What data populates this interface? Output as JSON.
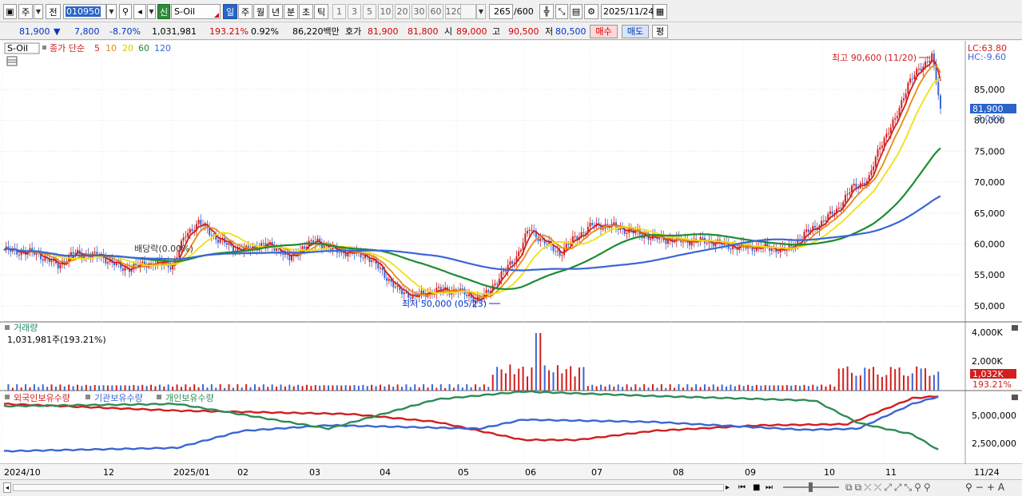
{
  "toolbar": {
    "market_button": "주",
    "prev_button": "전",
    "stock_code": "010950",
    "badge": "신",
    "stock_name": "S-Oil",
    "periods": [
      "일",
      "주",
      "월",
      "년",
      "분",
      "초",
      "틱"
    ],
    "active_period": "일",
    "minute_intervals": [
      "1",
      "3",
      "5",
      "10",
      "20",
      "30",
      "60",
      "120"
    ],
    "count_value": "265",
    "count_max": "/600",
    "date": "2025/11/24"
  },
  "quote": {
    "price": "81,900",
    "change": "7,800",
    "change_pct": "-8.70%",
    "volume": "1,031,981",
    "volume_ratio": "193.21%",
    "turnover_pct": "0.92%",
    "amount": "86,220백만",
    "bid_label": "호가",
    "ask": "81,900",
    "bid": "81,800",
    "open_label": "시",
    "open": "89,000",
    "high_label": "고",
    "high": "90,500",
    "low_label": "저",
    "low": "80,500",
    "buy_button": "매수",
    "sell_button": "매도",
    "eval_button": "평"
  },
  "price_panel": {
    "stock_label": "S-Oil",
    "ma_label": "종가 단순",
    "ma_periods": [
      {
        "label": "5",
        "color": "#d21e1e"
      },
      {
        "label": "10",
        "color": "#e98a15"
      },
      {
        "label": "20",
        "color": "#f0e012"
      },
      {
        "label": "60",
        "color": "#1e8c32"
      },
      {
        "label": "120",
        "color": "#3a66d4"
      }
    ],
    "lc_label": "LC:63.80",
    "hc_label": "HC:-9.60",
    "current_price_label": "81,900",
    "current_pct_label": "-7.04%",
    "high_annotation": "최고 90,600 (11/20)",
    "low_annotation": "최저 50,000 (05/23)",
    "dividend_annotation": "배당락(0.00%)",
    "y_ticks": [
      "85,000",
      "80,000",
      "75,000",
      "70,000",
      "65,000",
      "60,000",
      "55,000",
      "50,000"
    ]
  },
  "volume_panel": {
    "title": "거래량",
    "value_label": "1,031,981주(193.21%)",
    "y_ticks": [
      "4,000K",
      "2,000K"
    ],
    "current_label": "1,032K",
    "current_pct": "193.21%"
  },
  "holding_panel": {
    "series": [
      {
        "name": "외국인보유수량",
        "color": "#d21e1e"
      },
      {
        "name": "기관보유수량",
        "color": "#3a66d4"
      },
      {
        "name": "개인보유수량",
        "color": "#2e8b57"
      }
    ],
    "y_ticks": [
      "5,000,000",
      "2,500,000"
    ]
  },
  "x_axis": {
    "labels": [
      "2024/10",
      "12",
      "2025/01",
      "02",
      "03",
      "04",
      "05",
      "06",
      "07",
      "08",
      "09",
      "10",
      "11"
    ],
    "right_label": "11/24"
  },
  "colors": {
    "up": "#d21e1e",
    "down": "#3a66d4",
    "accent": "#2a64c8"
  }
}
